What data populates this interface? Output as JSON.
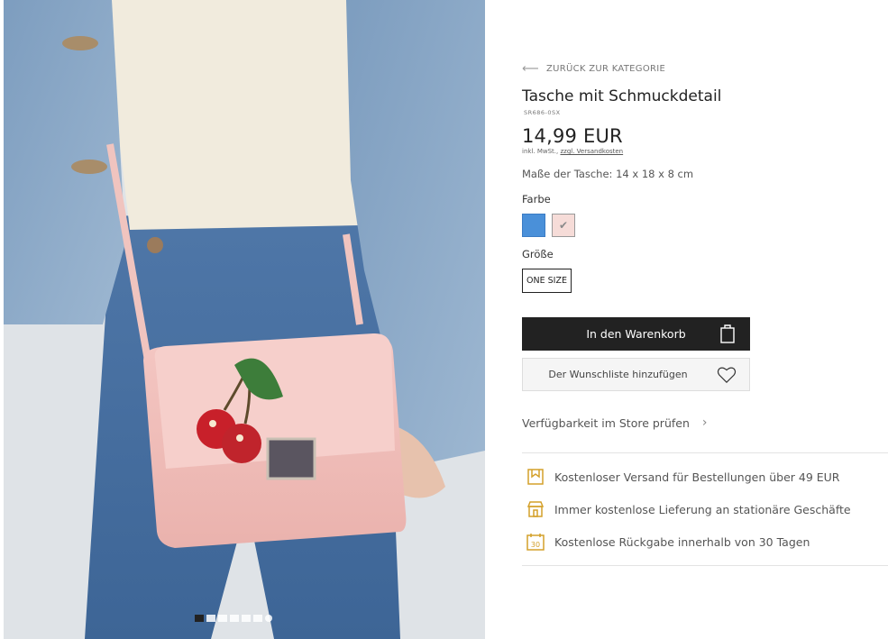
{
  "gallery": {
    "dots": 7,
    "active_dot": 0
  },
  "product": {
    "back_label": "ZURÜCK ZUR KATEGORIE",
    "title": "Tasche mit Schmuckdetail",
    "sku": "SR686-0SX",
    "price": "14,99 EUR",
    "tax_text": "inkl. MwSt., ",
    "shipping_link": "zzgl. Versandkosten",
    "dimensions": "Maße der Tasche: 14 x 18 x 8 cm",
    "color_label": "Farbe",
    "colors": [
      "#4a90d9",
      "#f6dcd8"
    ],
    "selected_color": 1,
    "size_label": "Größe",
    "size_value": "ONE SIZE",
    "cart_button": "In den Warenkorb",
    "wishlist_button": "Der Wunschliste hinzufügen",
    "store_availability": "Verfügbarkeit im Store prüfen"
  },
  "benefits": [
    {
      "icon": "shipping-icon",
      "text": "Kostenloser Versand für Bestellungen über 49 EUR"
    },
    {
      "icon": "store-icon",
      "text": "Immer kostenlose Lieferung an stationäre Geschäfte"
    },
    {
      "icon": "calendar-30-icon",
      "text": "Kostenlose Rückgabe innerhalb von 30 Tagen"
    }
  ],
  "colors": {
    "accent_gold": "#d4a02a",
    "button_dark": "#222222"
  }
}
